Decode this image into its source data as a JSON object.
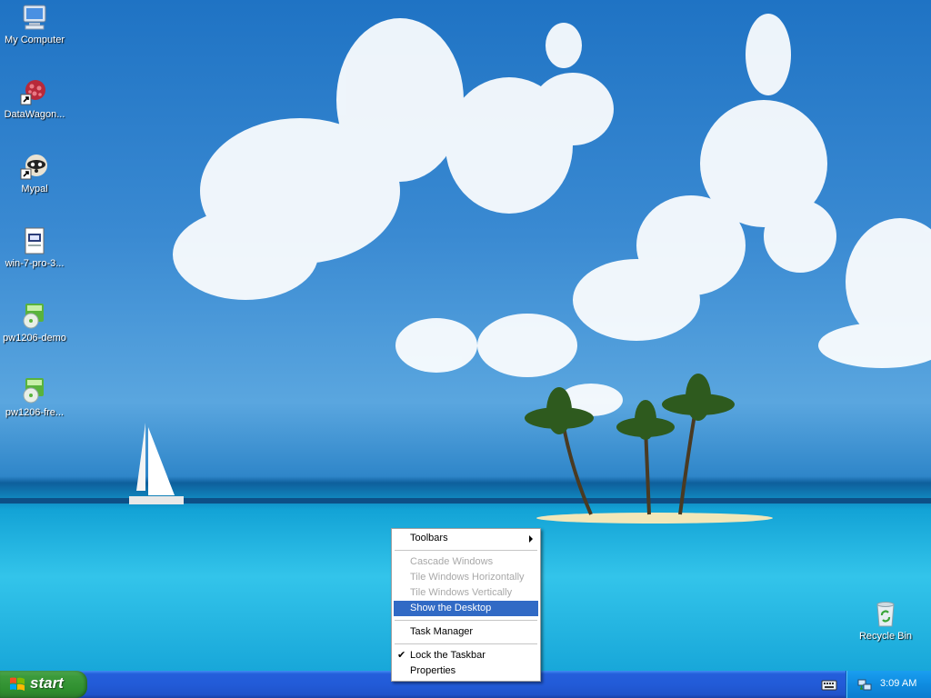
{
  "desktop": {
    "icons": [
      {
        "label": "My Computer",
        "icon": "my-computer-icon"
      },
      {
        "label": "DataWagon...",
        "icon": "datawagon-shortcut-icon"
      },
      {
        "label": "Mypal",
        "icon": "mypal-browser-shortcut-icon"
      },
      {
        "label": "win-7-pro-3...",
        "icon": "document-file-icon"
      },
      {
        "label": "pw1206-demo",
        "icon": "installer-package-icon"
      },
      {
        "label": "pw1206-fre...",
        "icon": "installer-package-icon"
      },
      {
        "label": "Recycle Bin",
        "icon": "recycle-bin-icon"
      }
    ]
  },
  "context_menu": {
    "items": {
      "toolbars": "Toolbars",
      "cascade": "Cascade Windows",
      "tile_h": "Tile Windows Horizontally",
      "tile_v": "Tile Windows Vertically",
      "show_desktop": "Show the Desktop",
      "task_manager": "Task Manager",
      "lock_taskbar": "Lock the Taskbar",
      "lock_check": "✔",
      "properties": "Properties"
    },
    "highlight_color": "#316ac5",
    "disabled_color": "#a8a8a8"
  },
  "taskbar": {
    "start_label": "start",
    "clock": "3:09 AM",
    "tray_icons": [
      "keyboard-icon",
      "network-icon"
    ]
  }
}
